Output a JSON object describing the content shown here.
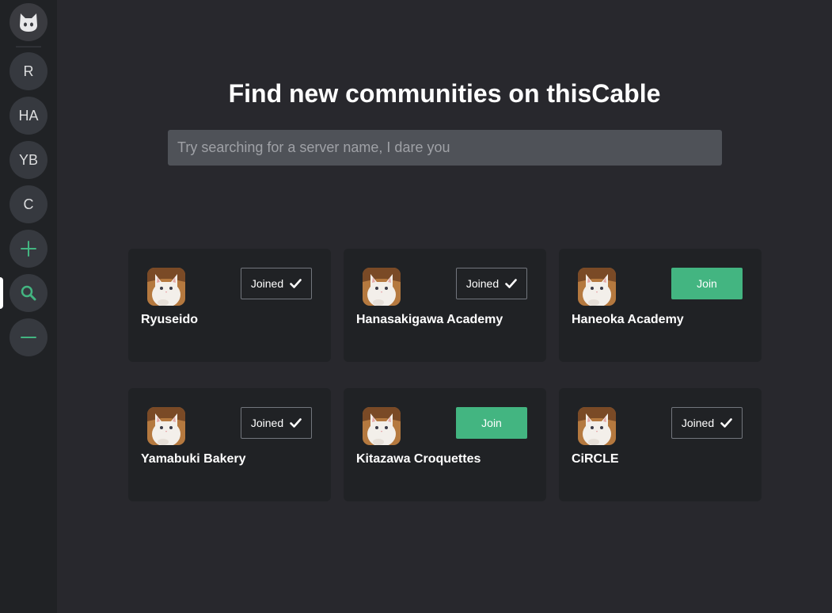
{
  "sidebar": {
    "home_icon": "cat-logo-icon",
    "servers": [
      {
        "label": "R",
        "name": "Ryuseido"
      },
      {
        "label": "HA",
        "name": "Hanasakigawa Academy"
      },
      {
        "label": "YB",
        "name": "Yamabuki Bakery"
      },
      {
        "label": "C",
        "name": "CiRCLE"
      }
    ],
    "actions": [
      {
        "icon": "plus-icon",
        "action": "add-server"
      },
      {
        "icon": "search-icon",
        "action": "explore",
        "active": true
      },
      {
        "icon": "minus-icon",
        "action": "leave-server"
      }
    ],
    "accent_color": "#43b581"
  },
  "main": {
    "title": "Find new communities on thisCable",
    "search": {
      "value": "",
      "placeholder": "Try searching for a server name, I dare you"
    },
    "communities": [
      {
        "name": "Ryuseido",
        "status": "joined",
        "button_label": "Joined",
        "avatar": "white-cat-avatar"
      },
      {
        "name": "Hanasakigawa Academy",
        "status": "joined",
        "button_label": "Joined",
        "avatar": "white-cat-avatar"
      },
      {
        "name": "Haneoka Academy",
        "status": "join",
        "button_label": "Join",
        "avatar": "white-cat-avatar"
      },
      {
        "name": "Yamabuki Bakery",
        "status": "joined",
        "button_label": "Joined",
        "avatar": "white-cat-avatar"
      },
      {
        "name": "Kitazawa Croquettes",
        "status": "join",
        "button_label": "Join",
        "avatar": "white-cat-avatar"
      },
      {
        "name": "CiRCLE",
        "status": "joined",
        "button_label": "Joined",
        "avatar": "white-cat-avatar"
      }
    ]
  }
}
